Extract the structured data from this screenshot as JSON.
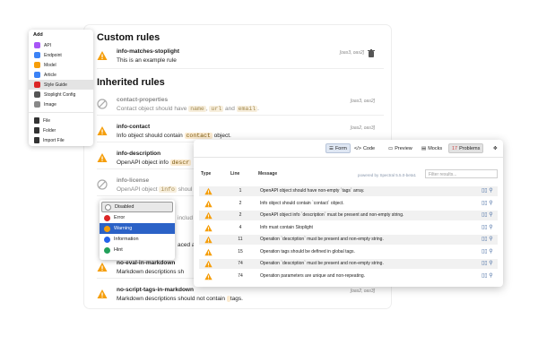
{
  "main": {
    "custom_title": "Custom rules",
    "inherited_title": "Inherited rules",
    "custom_rules": [
      {
        "name": "info-matches-stoplight",
        "desc": "This is an example rule",
        "formats": "[oas3, oas2]"
      }
    ],
    "rules": [
      {
        "name": "contact-properties",
        "desc_pre": "Contact object should have ",
        "codes": [
          "name",
          "url",
          "email"
        ],
        "desc_post": ".",
        "formats": "[oas3, oas2]",
        "disabled": true
      },
      {
        "name": "info-contact",
        "desc_pre": "Info object should contain ",
        "codes": [
          "contact"
        ],
        "desc_post": " object.",
        "formats": "[oas2, oas3]",
        "disabled": false
      },
      {
        "name": "info-description",
        "desc_pre": "OpenAPI object info ",
        "codes": [
          "descr"
        ],
        "desc_post": "",
        "formats": "",
        "disabled": false
      },
      {
        "name": "info-license",
        "desc_pre": "OpenAPI object ",
        "codes": [
          "info"
        ],
        "desc_post": " shoul",
        "formats": "",
        "disabled": true
      },
      {
        "name": "no-eval-in-markdown",
        "desc_pre": "Markdown descriptions sh",
        "codes": [],
        "desc_post": "",
        "formats": "",
        "disabled": false
      },
      {
        "name": "no-script-tags-in-markdown",
        "desc_pre": "Markdown descriptions should not contain ",
        "codes": [
          ""
        ],
        "desc_post": " tags.",
        "formats": "[oas2, oas3]",
        "disabled": false
      }
    ],
    "peek_texts": [
      "includ",
      "aced an"
    ]
  },
  "add_menu": {
    "title": "Add",
    "items": [
      {
        "label": "API",
        "color": "#a855f7"
      },
      {
        "label": "Endpoint",
        "color": "#3b82f6"
      },
      {
        "label": "Model",
        "color": "#f59e0b"
      },
      {
        "label": "Article",
        "color": "#3b82f6"
      },
      {
        "label": "Style Guide",
        "color": "#dc2626"
      },
      {
        "label": "Stoplight Config",
        "color": "#555555"
      },
      {
        "label": "Image",
        "color": "#888888"
      }
    ],
    "file_items": [
      "File",
      "Folder",
      "Import File"
    ]
  },
  "severity_menu": {
    "items": [
      {
        "label": "Disabled",
        "color": "#888888"
      },
      {
        "label": "Error",
        "color": "#dc2626"
      },
      {
        "label": "Warning",
        "color": "#f59e0b"
      },
      {
        "label": "Information",
        "color": "#2563eb"
      },
      {
        "label": "Hint",
        "color": "#22a05a"
      }
    ],
    "selected": "Warning"
  },
  "panel": {
    "tabs": {
      "form": "Form",
      "code": "Code",
      "preview": "Preview",
      "mocks": "Mocks",
      "problems_count": "17",
      "problems": "Problems"
    },
    "headers": {
      "type": "Type",
      "line": "Line",
      "message": "Message"
    },
    "powered_by": "powered by Spectral 5.5.0-beta1",
    "filter_placeholder": "Filter results...",
    "rows": [
      {
        "line": "1",
        "message": "OpenAPI object should have non-empty `tags` array."
      },
      {
        "line": "2",
        "message": "Info object should contain `contact` object."
      },
      {
        "line": "2",
        "message": "OpenAPI object info `description` must be present and non-empty string."
      },
      {
        "line": "4",
        "message": "Info must contain Stoplight"
      },
      {
        "line": "11",
        "message": "Operation `description` must be present and non-empty string."
      },
      {
        "line": "15",
        "message": "Operation tags should be defined in global tags."
      },
      {
        "line": "74",
        "message": "Operation `description` must be present and non-empty string."
      },
      {
        "line": "74",
        "message": "Operation parameters are unique and non-repeating."
      }
    ]
  }
}
